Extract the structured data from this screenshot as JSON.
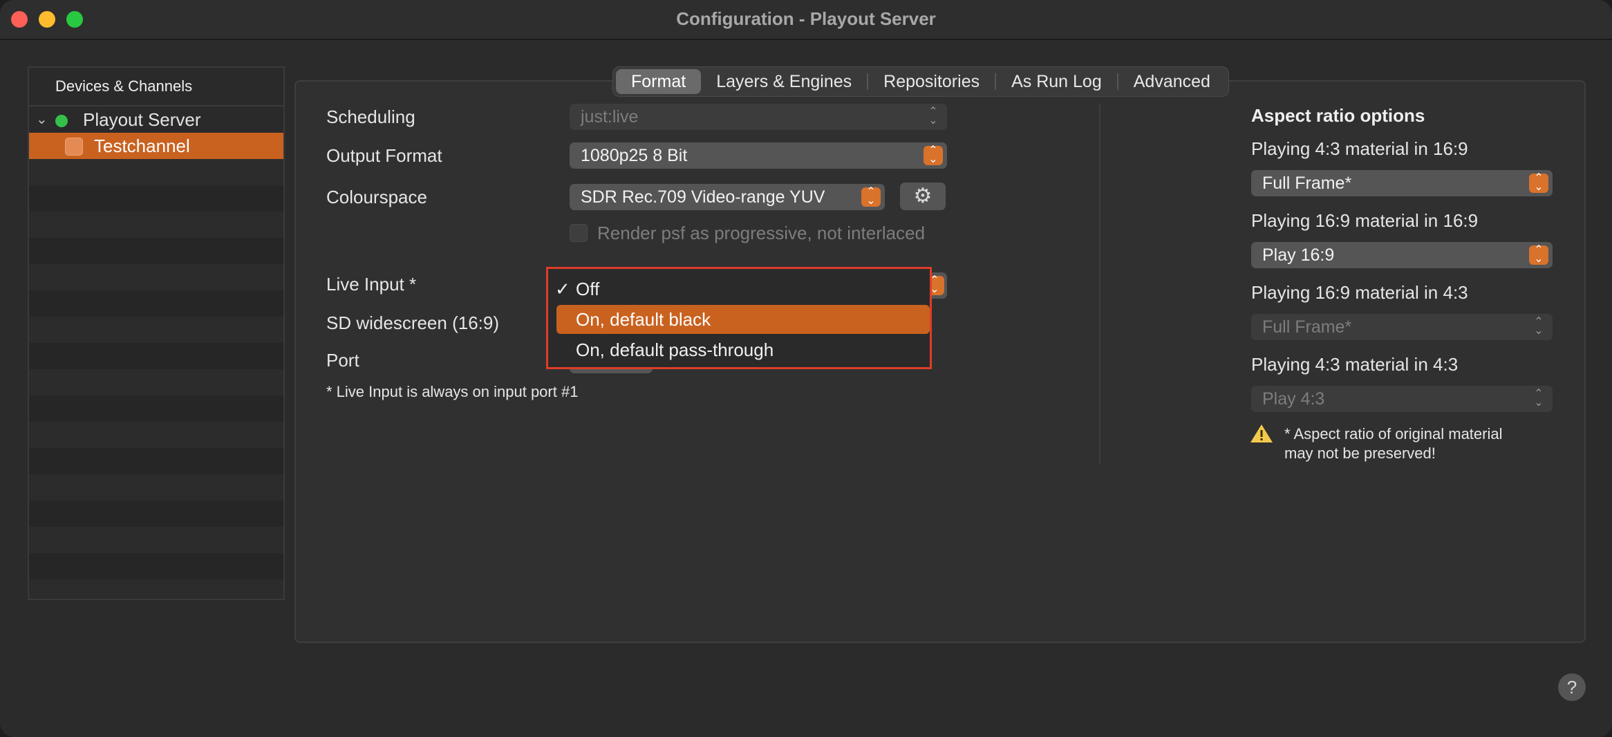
{
  "window": {
    "title": "Configuration - Playout Server"
  },
  "sidebar": {
    "header": "Devices & Channels",
    "server": {
      "label": "Playout Server",
      "status_color": "#34c04a"
    },
    "channel": {
      "label": "Testchannel"
    }
  },
  "tabs": [
    "Format",
    "Layers & Engines",
    "Repositories",
    "As Run Log",
    "Advanced"
  ],
  "active_tab": "Format",
  "form": {
    "scheduling": {
      "label": "Scheduling",
      "value": "just:live"
    },
    "output_format": {
      "label": "Output Format",
      "value": "1080p25 8 Bit"
    },
    "colourspace": {
      "label": "Colourspace",
      "value": "SDR Rec.709 Video-range YUV"
    },
    "render_psf": {
      "label": "Render psf as progressive, not interlaced"
    },
    "live_input": {
      "label": "Live Input *"
    },
    "sd_widescreen": {
      "label": "SD widescreen (16:9)"
    },
    "port": {
      "label": "Port"
    },
    "note": "* Live Input is always on input port #1"
  },
  "live_input_popup": {
    "items": [
      "Off",
      "On, default black",
      "On, default pass-through"
    ],
    "checked": "Off",
    "highlighted": "On, default black",
    "checkmark": "✓"
  },
  "aspect": {
    "title": "Aspect ratio options",
    "options": [
      {
        "label": "Playing 4:3 material in 16:9",
        "value": "Full Frame*"
      },
      {
        "label": "Playing 16:9 material in 16:9",
        "value": "Play 16:9"
      },
      {
        "label": "Playing 16:9 material in 4:3",
        "value": "Full Frame*"
      },
      {
        "label": "Playing 4:3 material in 4:3",
        "value": "Play 4:3"
      }
    ],
    "warning": "* Aspect ratio of original material may not be preserved!"
  },
  "help": "?",
  "colors": {
    "accent": "#c9621f",
    "popup_border": "#e03c2a"
  }
}
